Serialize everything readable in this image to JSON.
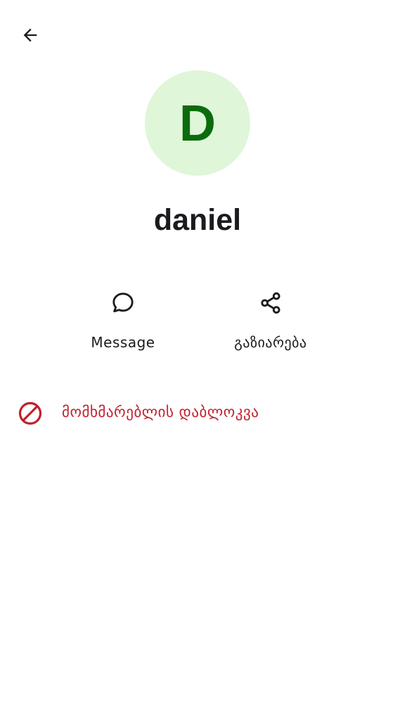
{
  "header": {
    "back_icon": "arrow-back-icon"
  },
  "profile": {
    "avatar_letter": "D",
    "name": "daniel"
  },
  "actions": [
    {
      "label": "Message",
      "icon": "chat-bubble-icon"
    },
    {
      "label": "გაზიარება",
      "icon": "share-icon"
    }
  ],
  "block": {
    "label": "მომხმარებლის დაბლოკვა",
    "icon": "block-icon"
  },
  "colors": {
    "avatar_bg": "#dff6d9",
    "avatar_letter": "#0c6b0c",
    "danger": "#c0212e",
    "text": "#1b1b1f"
  }
}
